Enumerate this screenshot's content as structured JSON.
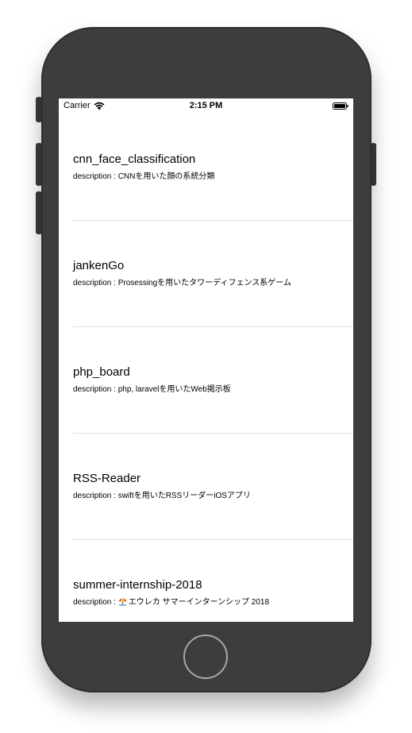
{
  "status_bar": {
    "carrier": "Carrier",
    "time": "2:15 PM"
  },
  "repos": [
    {
      "title": "cnn_face_classification",
      "description": "description : CNNを用いた顔の系統分類"
    },
    {
      "title": "jankenGo",
      "description": "description : Prosessingを用いたタワーディフェンス系ゲーム"
    },
    {
      "title": "php_board",
      "description": "description : php, laravelを用いたWeb掲示板"
    },
    {
      "title": "RSS-Reader",
      "description": "description : swiftを用いたRSSリーダーiOSアプリ"
    },
    {
      "title": "summer-internship-2018",
      "description_prefix": "description : ",
      "description_icon": "beach-umbrella-icon",
      "description_text": "エウレカ サマーインターンシップ 2018"
    }
  ],
  "colors": {
    "device_body": "#3d3d3d",
    "separator": "#e3e3e3",
    "home_button_ring": "#a8a8a8"
  }
}
